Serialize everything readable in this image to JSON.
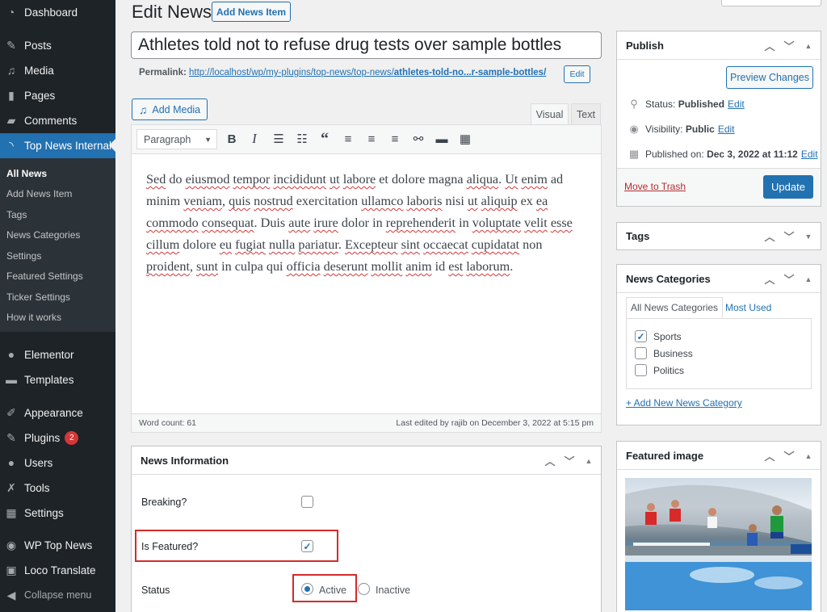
{
  "sidebar": {
    "items": [
      {
        "label": "Dashboard",
        "icon": "dashboard-icon"
      },
      {
        "label": "Posts",
        "icon": "pin-icon"
      },
      {
        "label": "Media",
        "icon": "media-icon"
      },
      {
        "label": "Pages",
        "icon": "pages-icon"
      },
      {
        "label": "Comments",
        "icon": "comment-icon"
      },
      {
        "label": "Top News Internal",
        "icon": "rss-icon",
        "active": true
      },
      {
        "label": "Elementor",
        "icon": "elementor-icon"
      },
      {
        "label": "Templates",
        "icon": "folder-icon"
      },
      {
        "label": "Appearance",
        "icon": "brush-icon"
      },
      {
        "label": "Plugins",
        "icon": "plug-icon",
        "badge": "2"
      },
      {
        "label": "Users",
        "icon": "user-icon"
      },
      {
        "label": "Tools",
        "icon": "wrench-icon"
      },
      {
        "label": "Settings",
        "icon": "settings-icon"
      },
      {
        "label": "WP Top News",
        "icon": "globe-icon"
      },
      {
        "label": "Loco Translate",
        "icon": "translate-icon"
      },
      {
        "label": "Collapse menu",
        "icon": "collapse-icon"
      }
    ],
    "submenu": [
      {
        "label": "All News",
        "current": true
      },
      {
        "label": "Add News Item"
      },
      {
        "label": "Tags"
      },
      {
        "label": "News Categories"
      },
      {
        "label": "Settings"
      },
      {
        "label": "Featured Settings"
      },
      {
        "label": "Ticker Settings"
      },
      {
        "label": "How it works"
      }
    ]
  },
  "header": {
    "title": "Edit News",
    "add_new_label": "Add News Item"
  },
  "post": {
    "title": "Athletes told not to refuse drug tests over sample bottles",
    "permalink_label": "Permalink:",
    "permalink_base": "http://localhost/wp/my-plugins/top-news/top-news/",
    "permalink_slug": "athletes-told-no...r-sample-bottles/",
    "permalink_edit": "Edit"
  },
  "editor": {
    "add_media_label": "Add Media",
    "tabs": [
      {
        "label": "Visual",
        "active": true
      },
      {
        "label": "Text"
      }
    ],
    "format_select": "Paragraph",
    "toolbar": [
      "bold",
      "italic",
      "bulleted-list",
      "numbered-list",
      "blockquote",
      "align-left",
      "align-center",
      "align-right",
      "link",
      "read-more",
      "toolbar-toggle"
    ],
    "content": "Sed do eiusmod tempor incididunt ut labore et dolore magna aliqua. Ut enim ad minim veniam, quis nostrud exercitation ullamco laboris nisi ut aliquip ex ea commodo consequat. Duis aute irure dolor in reprehenderit in voluptate velit esse cillum dolore eu fugiat nulla pariatur. Excepteur sint occaecat cupidatat non proident, sunt in culpa qui officia deserunt mollit anim id est laborum.",
    "word_count": "Word count: 61",
    "last_edited": "Last edited by rajib on December 3, 2022 at 5:15 pm"
  },
  "news_info": {
    "title": "News Information",
    "breaking_label": "Breaking?",
    "breaking_checked": false,
    "featured_label": "Is Featured?",
    "featured_checked": true,
    "status_label": "Status",
    "status_options": [
      "Active",
      "Inactive"
    ],
    "status_selected": "Active"
  },
  "publish": {
    "title": "Publish",
    "preview_label": "Preview Changes",
    "status_label": "Status:",
    "status_value": "Published",
    "visibility_label": "Visibility:",
    "visibility_value": "Public",
    "published_label": "Published on:",
    "published_value": "Dec 3, 2022 at 11:12",
    "edit_link": "Edit",
    "trash_label": "Move to Trash",
    "update_label": "Update"
  },
  "tags": {
    "title": "Tags"
  },
  "news_categories": {
    "title": "News Categories",
    "tab_all": "All News Categories",
    "tab_used": "Most Used",
    "items": [
      {
        "label": "Sports",
        "checked": true
      },
      {
        "label": "Business",
        "checked": false
      },
      {
        "label": "Politics",
        "checked": false
      }
    ],
    "add_new": "+ Add New News Category"
  },
  "featured_image": {
    "title": "Featured image",
    "alt": "Steeplechase runners splashing through water jump in a stadium"
  },
  "colors": {
    "accent": "#2271b1",
    "sidebar_bg": "#1d2327",
    "highlight": "#d42a2a",
    "badge": "#d63638"
  }
}
